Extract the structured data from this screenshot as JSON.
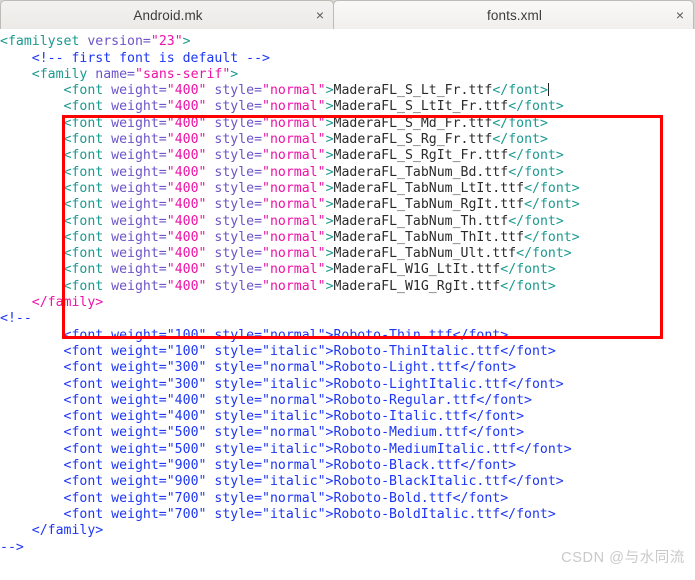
{
  "tabs": [
    {
      "label": "Android.mk",
      "close": "×",
      "active": false
    },
    {
      "label": "fonts.xml",
      "close": "×",
      "active": true
    }
  ],
  "editor": {
    "colors": {
      "tag": "#1a9a8f",
      "attr_name": "#6d54c8",
      "attr_value": "#ee11a8",
      "text": "#2b2b2b",
      "comment": "#1d36f5",
      "highlight_box": "#ff0000",
      "background": "#ffffff"
    },
    "cut_off_top_line": "?>",
    "lines": [
      {
        "indent": "",
        "type": "tag_open",
        "parts": [
          {
            "c": "tg",
            "t": "<familyset "
          },
          {
            "c": "at",
            "t": "version="
          },
          {
            "c": "av",
            "t": "\"23\""
          },
          {
            "c": "tg",
            "t": ">"
          }
        ]
      },
      {
        "indent": "    ",
        "type": "comment",
        "parts": [
          {
            "c": "cm",
            "t": "<!-- first font is default -->"
          }
        ]
      },
      {
        "indent": "    ",
        "type": "tag_open",
        "parts": [
          {
            "c": "tg",
            "t": "<family "
          },
          {
            "c": "at",
            "t": "name="
          },
          {
            "c": "av",
            "t": "\"sans-serif\""
          },
          {
            "c": "tg",
            "t": ">"
          }
        ]
      },
      {
        "indent": "        ",
        "type": "font",
        "weight": "400",
        "style": "normal",
        "file": "MaderaFL_S_Lt_Fr.ttf",
        "caret": true
      },
      {
        "indent": "        ",
        "type": "font",
        "weight": "400",
        "style": "normal",
        "file": "MaderaFL_S_LtIt_Fr.ttf"
      },
      {
        "indent": "        ",
        "type": "font",
        "weight": "400",
        "style": "normal",
        "file": "MaderaFL_S_Md_Fr.ttf"
      },
      {
        "indent": "        ",
        "type": "font",
        "weight": "400",
        "style": "normal",
        "file": "MaderaFL_S_Rg_Fr.ttf"
      },
      {
        "indent": "        ",
        "type": "font",
        "weight": "400",
        "style": "normal",
        "file": "MaderaFL_S_RgIt_Fr.ttf"
      },
      {
        "indent": "        ",
        "type": "font",
        "weight": "400",
        "style": "normal",
        "file": "MaderaFL_TabNum_Bd.ttf"
      },
      {
        "indent": "        ",
        "type": "font",
        "weight": "400",
        "style": "normal",
        "file": "MaderaFL_TabNum_LtIt.ttf"
      },
      {
        "indent": "        ",
        "type": "font",
        "weight": "400",
        "style": "normal",
        "file": "MaderaFL_TabNum_RgIt.ttf"
      },
      {
        "indent": "        ",
        "type": "font",
        "weight": "400",
        "style": "normal",
        "file": "MaderaFL_TabNum_Th.ttf"
      },
      {
        "indent": "        ",
        "type": "font",
        "weight": "400",
        "style": "normal",
        "file": "MaderaFL_TabNum_ThIt.ttf"
      },
      {
        "indent": "        ",
        "type": "font",
        "weight": "400",
        "style": "normal",
        "file": "MaderaFL_TabNum_Ult.ttf"
      },
      {
        "indent": "        ",
        "type": "font",
        "weight": "400",
        "style": "normal",
        "file": "MaderaFL_W1G_LtIt.ttf"
      },
      {
        "indent": "        ",
        "type": "font",
        "weight": "400",
        "style": "normal",
        "file": "MaderaFL_W1G_RgIt.ttf"
      },
      {
        "indent": "    ",
        "type": "tag_close",
        "parts": [
          {
            "c": "av",
            "t": "</family>"
          }
        ]
      },
      {
        "indent": "",
        "type": "comment",
        "parts": [
          {
            "c": "cm",
            "t": "<!--"
          }
        ]
      },
      {
        "indent": "        ",
        "type": "comment_font",
        "weight": "100",
        "style": "normal",
        "file": "Roboto-Thin.ttf"
      },
      {
        "indent": "        ",
        "type": "comment_font",
        "weight": "100",
        "style": "italic",
        "file": "Roboto-ThinItalic.ttf"
      },
      {
        "indent": "        ",
        "type": "comment_font",
        "weight": "300",
        "style": "normal",
        "file": "Roboto-Light.ttf"
      },
      {
        "indent": "        ",
        "type": "comment_font",
        "weight": "300",
        "style": "italic",
        "file": "Roboto-LightItalic.ttf"
      },
      {
        "indent": "        ",
        "type": "comment_font",
        "weight": "400",
        "style": "normal",
        "file": "Roboto-Regular.ttf"
      },
      {
        "indent": "        ",
        "type": "comment_font",
        "weight": "400",
        "style": "italic",
        "file": "Roboto-Italic.ttf"
      },
      {
        "indent": "        ",
        "type": "comment_font",
        "weight": "500",
        "style": "normal",
        "file": "Roboto-Medium.ttf"
      },
      {
        "indent": "        ",
        "type": "comment_font",
        "weight": "500",
        "style": "italic",
        "file": "Roboto-MediumItalic.ttf"
      },
      {
        "indent": "        ",
        "type": "comment_font",
        "weight": "900",
        "style": "normal",
        "file": "Roboto-Black.ttf"
      },
      {
        "indent": "        ",
        "type": "comment_font",
        "weight": "900",
        "style": "italic",
        "file": "Roboto-BlackItalic.ttf"
      },
      {
        "indent": "        ",
        "type": "comment_font",
        "weight": "700",
        "style": "normal",
        "file": "Roboto-Bold.ttf"
      },
      {
        "indent": "        ",
        "type": "comment_font",
        "weight": "700",
        "style": "italic",
        "file": "Roboto-BoldItalic.ttf"
      },
      {
        "indent": "    ",
        "type": "comment",
        "parts": [
          {
            "c": "cm",
            "t": "</family>"
          }
        ]
      },
      {
        "indent": "",
        "type": "comment",
        "parts": [
          {
            "c": "cm",
            "t": "-->"
          }
        ]
      }
    ]
  },
  "watermark": "CSDN @与水同流"
}
